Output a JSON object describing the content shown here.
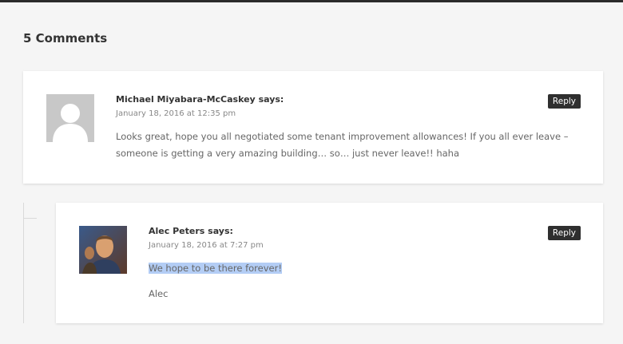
{
  "comments_title": "5 Comments",
  "comments": [
    {
      "author": "Michael Miyabara-McCaskey",
      "says": "says:",
      "date": "January 18, 2016 at 12:35 pm",
      "body": [
        "Looks great, hope you all negotiated some tenant improvement allowances! If you all ever leave – someone is getting a very amazing building… so… just never leave!! haha"
      ],
      "reply_label": "Reply",
      "avatar": "default-person-icon"
    },
    {
      "author": "Alec Peters",
      "says": "says:",
      "date": "January 18, 2016 at 7:27 pm",
      "body": [
        "We hope to be there forever!",
        "Alec"
      ],
      "reply_label": "Reply",
      "avatar": "user-photo"
    }
  ],
  "colors": {
    "reply_bg": "#2f2f2f",
    "selection": "#b3cdf5",
    "page_bg": "#f5f5f5"
  }
}
